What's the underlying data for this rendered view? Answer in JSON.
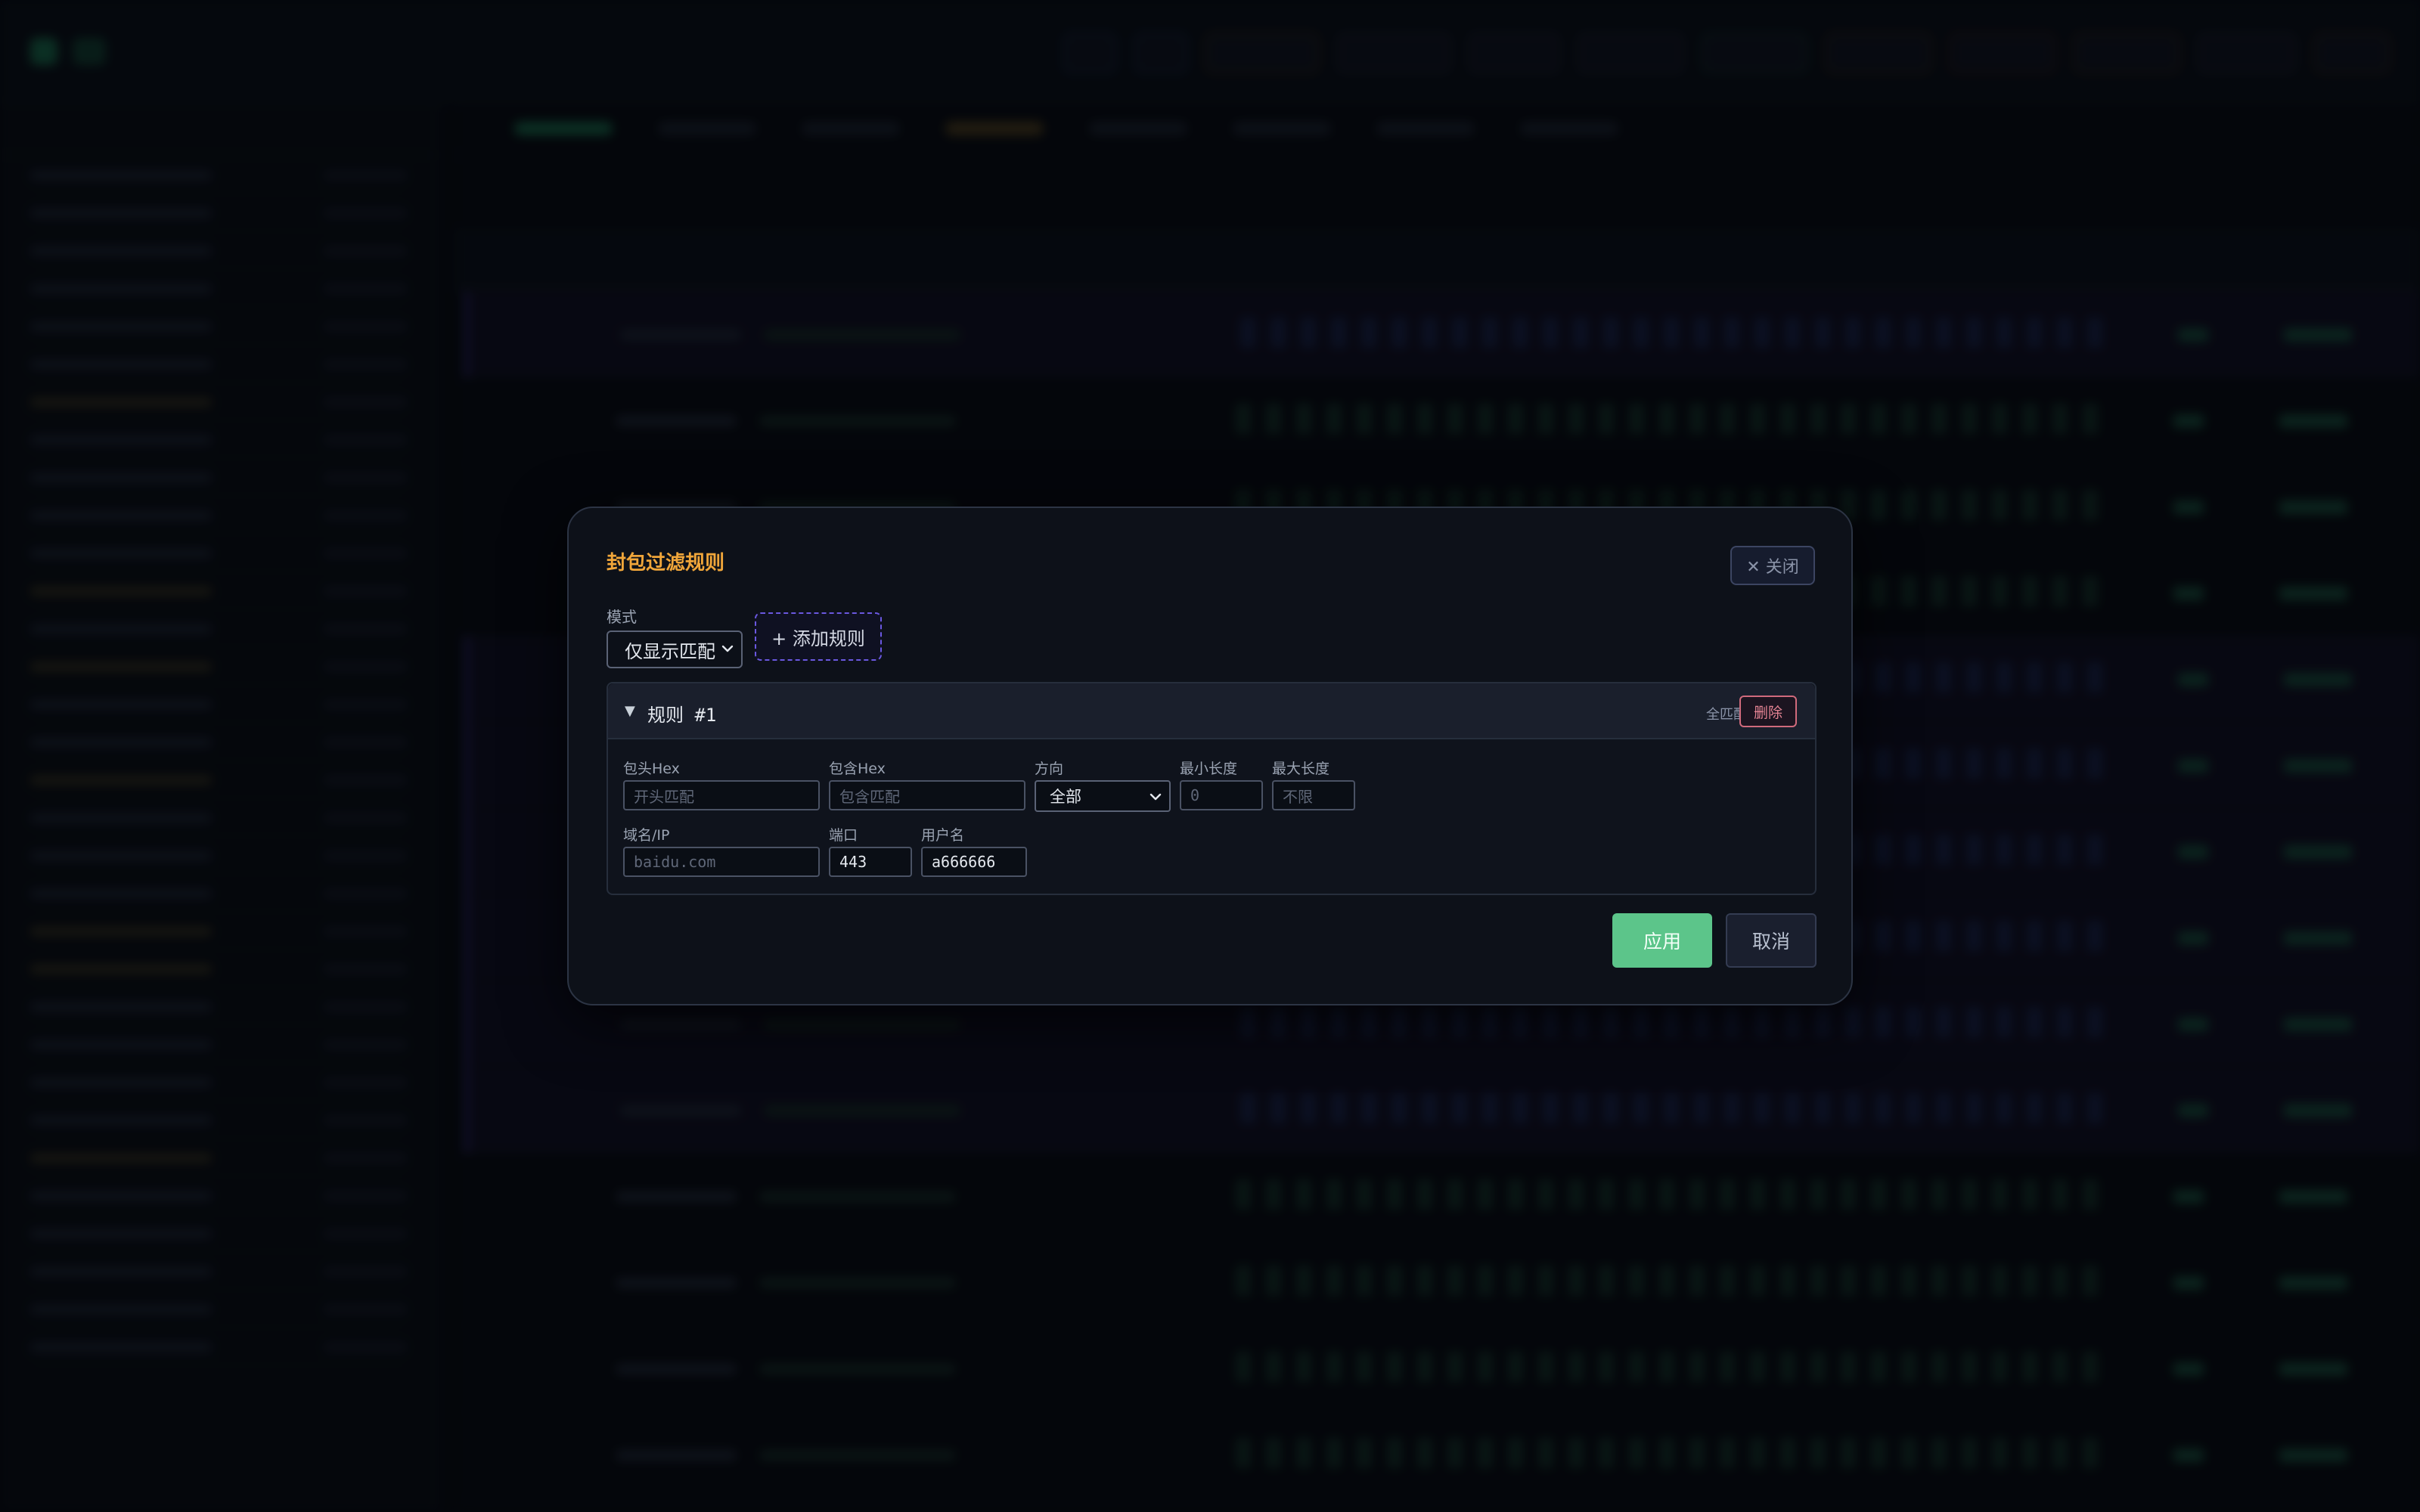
{
  "modal": {
    "title": "封包过滤规则",
    "close_label": "✕ 关闭",
    "mode_label": "模式",
    "mode_value": "仅显示匹配",
    "add_rule_label": "+ 添加规则",
    "apply_label": "应用",
    "cancel_label": "取消",
    "rule": {
      "toggle": "▼",
      "title": "规则 #1",
      "match_mode": "全匹配",
      "delete_label": "删除",
      "fields": {
        "head_hex": {
          "label": "包头Hex",
          "value": "",
          "placeholder": "开头匹配"
        },
        "contains_hex": {
          "label": "包含Hex",
          "value": "",
          "placeholder": "包含匹配"
        },
        "direction": {
          "label": "方向",
          "value": "全部"
        },
        "min_len": {
          "label": "最小长度",
          "value": "",
          "placeholder": "0"
        },
        "max_len": {
          "label": "最大长度",
          "value": "",
          "placeholder": "不限"
        },
        "domain": {
          "label": "域名/IP",
          "value": "",
          "placeholder": "baidu.com"
        },
        "port": {
          "label": "端口",
          "value": "443"
        },
        "username": {
          "label": "用户名",
          "value": "a666666"
        }
      }
    }
  },
  "colors": {
    "title_accent": "#f0a63a",
    "apply_green": "#5cc58a",
    "delete_red": "#e58494",
    "add_rule_border": "#6a58e0"
  }
}
